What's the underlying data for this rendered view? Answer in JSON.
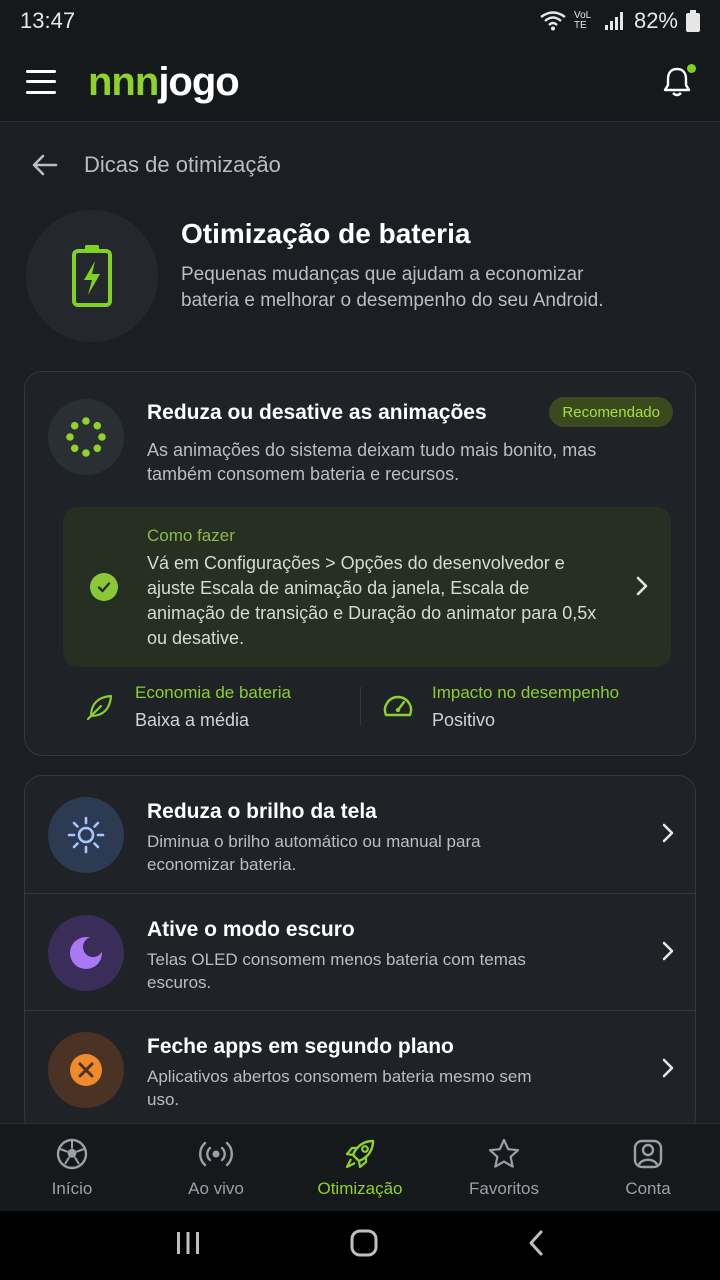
{
  "status": {
    "time": "13:47",
    "battery": "82%",
    "network_label": "VoLTE"
  },
  "app": {
    "logo_part1": "nnn",
    "logo_part2": "jogo",
    "accent": "#8fd22a"
  },
  "page": {
    "back_title": "Dicas de otimização"
  },
  "hero": {
    "title": "Otimização de bateria",
    "description": "Pequenas mudanças que ajudam a economizar bateria e melhorar o desempenho do seu Android.",
    "icon": "battery-charging-icon"
  },
  "main_tip": {
    "title": "Reduza ou desative as animações",
    "badge": "Recomendado",
    "description": "As animações do sistema deixam tudo mais bonito, mas também consomem bateria e recursos.",
    "howto_label": "Como fazer",
    "howto_text": "Vá em Configurações > Opções do desenvolvedor e ajuste Escala de animação da janela, Escala de animação de transição e Duração do animator para 0,5x ou desative.",
    "stats": [
      {
        "label": "Economia de bateria",
        "value": "Baixa a média",
        "icon": "leaf-icon"
      },
      {
        "label": "Impacto no desempenho",
        "value": "Positivo",
        "icon": "speedometer-icon"
      }
    ]
  },
  "tips": [
    {
      "title": "Reduza o brilho da tela",
      "description": "Diminua o brilho automático ou manual para economizar bateria.",
      "icon": "sun-icon",
      "color": "#8fb4ff"
    },
    {
      "title": "Ative o modo escuro",
      "description": "Telas OLED consomem menos bateria com temas escuros.",
      "icon": "moon-icon",
      "color": "#a979f5"
    },
    {
      "title": "Feche apps em segundo plano",
      "description": "Aplicativos abertos consomem bateria mesmo sem uso.",
      "icon": "close-circle-icon",
      "color": "#f08a2a"
    }
  ],
  "nav": [
    {
      "label": "Início",
      "icon": "soccer-ball-icon",
      "active": false
    },
    {
      "label": "Ao vivo",
      "icon": "broadcast-icon",
      "active": false
    },
    {
      "label": "Otimização",
      "icon": "rocket-icon",
      "active": true
    },
    {
      "label": "Favoritos",
      "icon": "star-icon",
      "active": false
    },
    {
      "label": "Conta",
      "icon": "user-icon",
      "active": false
    }
  ]
}
